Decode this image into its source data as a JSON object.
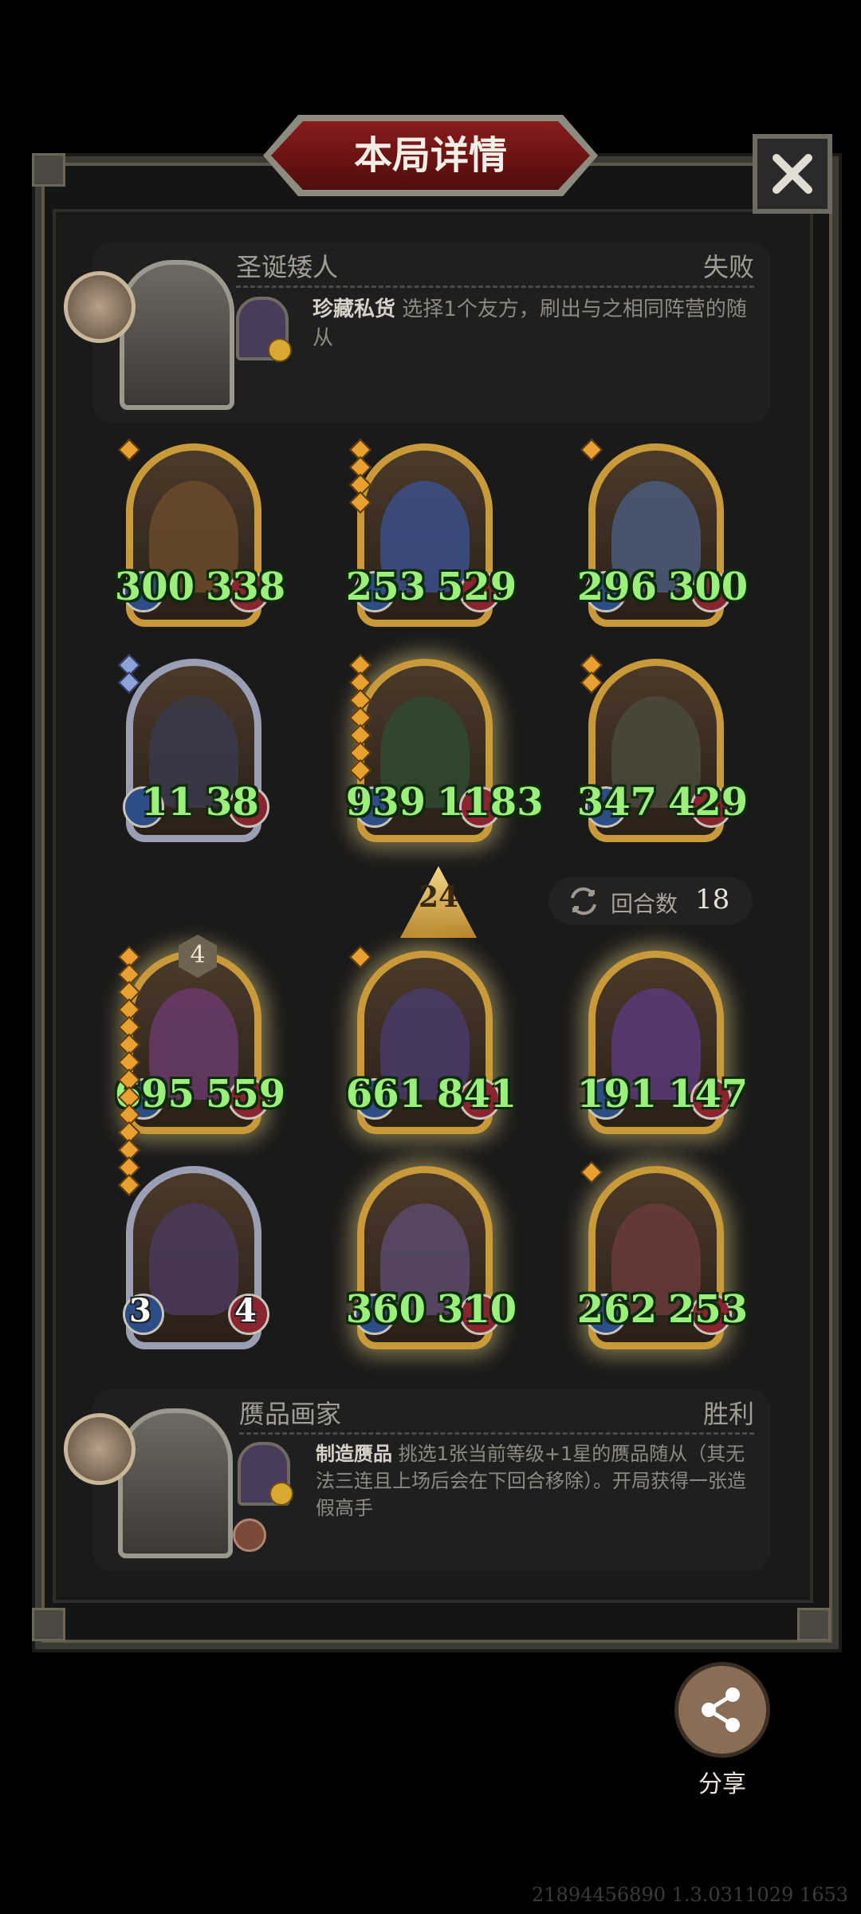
{
  "title": "本局详情",
  "opponent": {
    "name": "圣诞矮人",
    "result": "失败",
    "skill_name": "珍藏私货",
    "skill_desc": "选择1个友方，刷出与之相同阵营的随从",
    "coin_icon": "coin-icon"
  },
  "board_top": [
    {
      "atk": "300",
      "hp": "338"
    },
    {
      "atk": "253",
      "hp": "529"
    },
    {
      "atk": "296",
      "hp": "300"
    },
    {
      "atk": "11",
      "hp": "38"
    },
    {
      "atk": "939",
      "hp": "1183"
    },
    {
      "atk": "347",
      "hp": "429"
    }
  ],
  "center": {
    "level": "24",
    "turn_label": "回合数",
    "turn_value": "18",
    "badge_level": "4"
  },
  "board_bottom": [
    {
      "atk": "695",
      "hp": "559"
    },
    {
      "atk": "661",
      "hp": "841"
    },
    {
      "atk": "191",
      "hp": "147"
    },
    {
      "atk": "3",
      "hp": "4"
    },
    {
      "atk": "360",
      "hp": "310"
    },
    {
      "atk": "262",
      "hp": "253"
    }
  ],
  "player": {
    "name": "赝品画家",
    "result": "胜利",
    "skill_name": "制造赝品",
    "skill_desc": "挑选1张当前等级+1星的赝品随从（其无法三连且上场后会在下回合移除）。开局获得一张造假高手"
  },
  "share_label": "分享",
  "footer_id": "21894456890 1.3.0311029 1653",
  "colors": {
    "stat_green": "#9af07a",
    "frame_gold": "#c99a3a",
    "title_red": "#8a1c1c"
  }
}
